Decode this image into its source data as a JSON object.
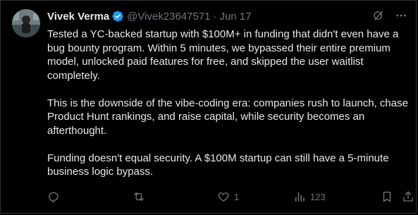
{
  "author": {
    "name": "Vivek Verma",
    "handle": "@Vivek23647571",
    "date": "Jun 17",
    "separator": "·",
    "verified": true,
    "verified_color": "#1d9bf0"
  },
  "top_actions": [
    "grok-icon",
    "more-icon"
  ],
  "tweet": {
    "paragraphs": [
      "Tested a YC-backed startup with $100M+ in funding that didn't even have a bug bounty program. Within 5 minutes, we bypassed their entire premium model, unlocked paid features for free, and skipped the user waitlist completely.",
      "This is the downside of the vibe-coding era: companies rush to launch, chase Product Hunt rankings, and raise capital, while security becomes an afterthought.",
      "Funding doesn't equal security. A $100M startup can still have a 5-minute business logic bypass."
    ]
  },
  "stats": {
    "replies": "",
    "retweets": "",
    "likes": "1",
    "views": "123"
  },
  "colors": {
    "background": "#000000",
    "text": "#e7e9ea",
    "muted": "#71767b",
    "border": "#2f3336"
  }
}
